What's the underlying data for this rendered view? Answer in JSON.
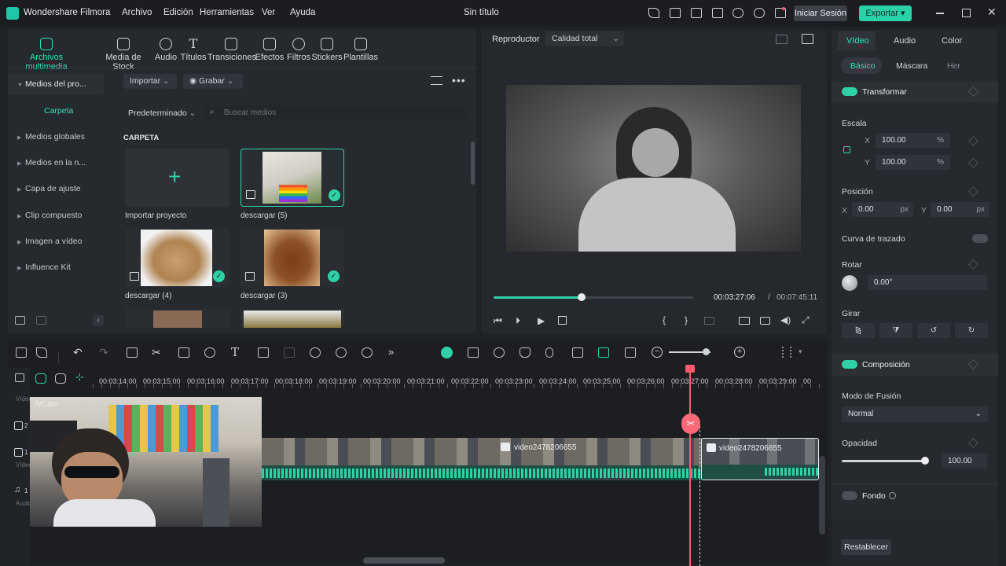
{
  "titlebar": {
    "app_name": "Wondershare Filmora",
    "menu": [
      "Archivo",
      "Edición",
      "Herramientas",
      "Ver",
      "Ayuda"
    ],
    "document_title": "Sin título",
    "login_label": "Iniciar Sesión",
    "export_label": "Exportar"
  },
  "media_toolbar": {
    "items": [
      "Archivos multimedia",
      "Media de Stock",
      "Audio",
      "Títulos",
      "Transiciones",
      "Efectos",
      "Filtros",
      "Stickers",
      "Plantillas"
    ],
    "active": "Archivos multimedia"
  },
  "sidebar": {
    "items": [
      "Medios del pro...",
      "Carpeta",
      "Medios globales",
      "Medios en la n...",
      "Capa de ajuste",
      "Clip compuesto",
      "Imagen a vídeo",
      "Influence Kit"
    ]
  },
  "media": {
    "import_label": "Importar",
    "record_label": "Grabar",
    "sort_label": "Predeterminado",
    "search_placeholder": "Buscar medios",
    "folder_heading": "CARPETA",
    "items": [
      {
        "label": "Importar proyecto"
      },
      {
        "label": "descargar (5)"
      },
      {
        "label": "descargar (4)"
      },
      {
        "label": "descargar (3)"
      }
    ]
  },
  "player": {
    "label": "Reproductor",
    "quality": "Calidad total",
    "current_time": "00:03:27:06",
    "total_time": "00:07:45:11",
    "progress": 0.44,
    "brace_open": "{",
    "brace_close": "}"
  },
  "props": {
    "tabs": [
      "Vídeo",
      "Audio",
      "Color"
    ],
    "subtabs": [
      "Básico",
      "Máscara",
      "Her"
    ],
    "transform": "Transformar",
    "scale": "Escala",
    "x_label": "X",
    "y_label": "Y",
    "scale_x": "100.00",
    "scale_y": "100.00",
    "percent": "%",
    "position": "Posición",
    "pos_x": "0.00",
    "pos_y": "0.00",
    "px": "px",
    "curve": "Curva de trazado",
    "rotate": "Rotar",
    "rotate_value": "0.00°",
    "flip": "Girar",
    "composition": "Composición",
    "blend_mode": "Modo de Fusión",
    "blend_value": "Normal",
    "opacity": "Opacidad",
    "opacity_value": "100.00",
    "background": "Fondo",
    "reset": "Restablecer"
  },
  "timeline": {
    "ruler": [
      "00:03:14:00",
      "00:03:15:00",
      "00:03:16:00",
      "00:03:17:00",
      "00:03:18:00",
      "00:03:19:00",
      "00:03:20:00",
      "00:03:21:00",
      "00:03:22:00",
      "00:03:23:00",
      "00:03:24:00",
      "00:03:25:00",
      "00:03:26:00",
      "00:03:27:00",
      "00:03:28:00",
      "00:03:29:00",
      "00:03:3"
    ],
    "clip1_label": "video2478206655",
    "clip2_label": "video2478206655",
    "track_labels": [
      "Vídeo",
      "2",
      "1",
      "Vídeo",
      "1",
      "Audio"
    ],
    "webcam_tag": "iVCam"
  },
  "colors": {
    "accent": "#2fd2a6",
    "playhead": "#ff5a6b"
  }
}
